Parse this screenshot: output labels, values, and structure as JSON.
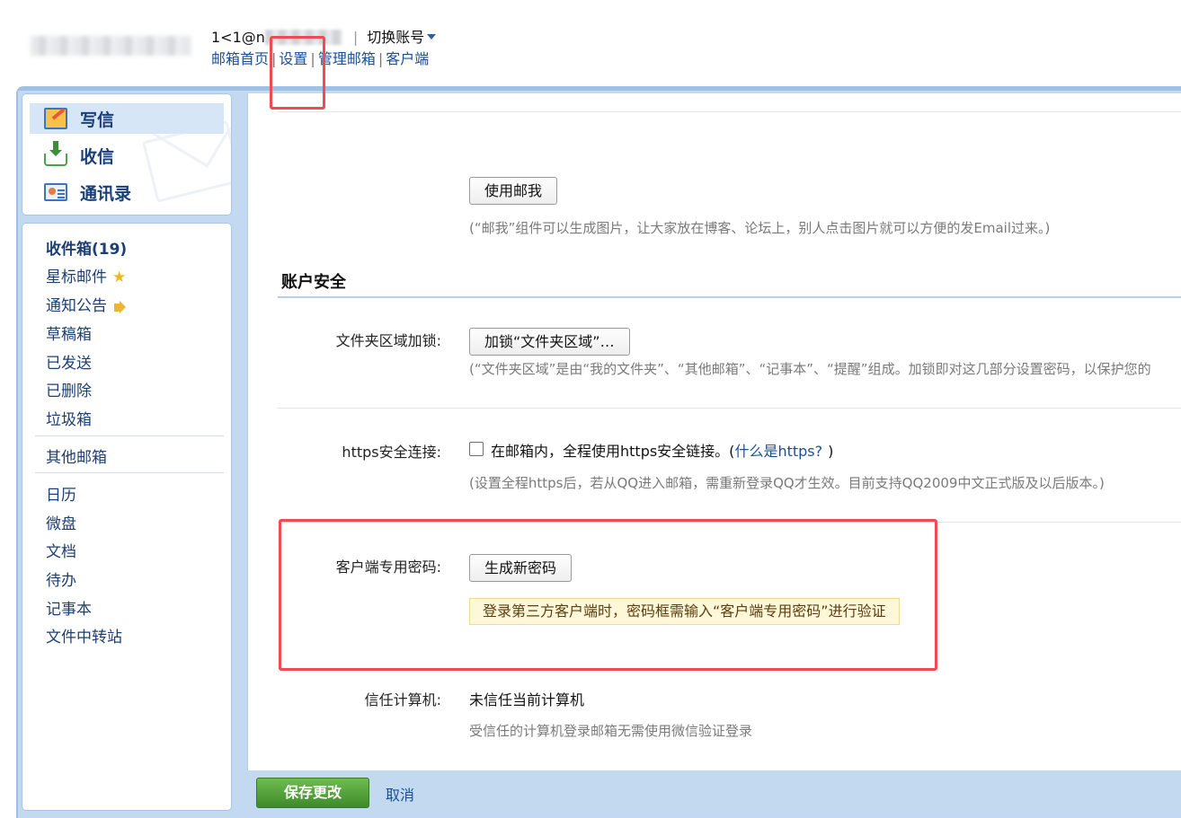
{
  "header": {
    "account_prefix": "1<1@n",
    "switch_account": "切换账号",
    "links": {
      "home": "邮箱首页",
      "settings": "设置",
      "manage": "管理邮箱",
      "client": "客户端"
    },
    "separator": "|"
  },
  "sidebar": {
    "quick": {
      "compose": "写信",
      "receive": "收信",
      "contacts": "通讯录"
    },
    "folders": {
      "inbox": "收件箱(19)",
      "starred": "星标邮件",
      "notice": "通知公告",
      "drafts": "草稿箱",
      "sent": "已发送",
      "deleted": "已删除",
      "spam": "垃圾箱",
      "other_mailbox": "其他邮箱",
      "calendar": "日历",
      "disk": "微盘",
      "docs": "文档",
      "todo": "待办",
      "notes": "记事本",
      "transfer": "文件中转站"
    },
    "star_glyph": "★"
  },
  "main": {
    "mailme": {
      "button": "使用邮我",
      "hint": "(“邮我”组件可以生成图片，让大家放在博客、论坛上，别人点击图片就可以方便的发Email过来。)"
    },
    "security_title": "账户安全",
    "folder_lock": {
      "label": "文件夹区域加锁:",
      "button": "加锁“文件夹区域”…",
      "hint": "(“文件夹区域”是由“我的文件夹”、“其他邮箱”、“记事本”、“提醒”组成。加锁即对这几部分设置密码，以保护您的"
    },
    "https": {
      "label": "https安全连接:",
      "checkbox_text": "在邮箱内，全程使用https安全链接。(",
      "what_link": "什么是https?",
      "close_paren": ")",
      "hint": "(设置全程https后，若从QQ进入邮箱，需重新登录QQ才生效。目前支持QQ2009中文正式版及以后版本。)",
      "checked": false
    },
    "client_password": {
      "label": "客户端专用密码:",
      "button": "生成新密码",
      "tip": "登录第三方客户端时，密码框需输入“客户端专用密码”进行验证"
    },
    "trusted": {
      "label": "信任计算机:",
      "value": "未信任当前计算机",
      "hint": "受信任的计算机登录邮箱无需使用微信验证登录"
    }
  },
  "footer": {
    "save": "保存更改",
    "cancel": "取消"
  },
  "colors": {
    "accent_blue": "#9fc1e6",
    "link": "#1a4f96",
    "save_green": "#4c9a33",
    "annotation_red": "#ee4b55"
  }
}
